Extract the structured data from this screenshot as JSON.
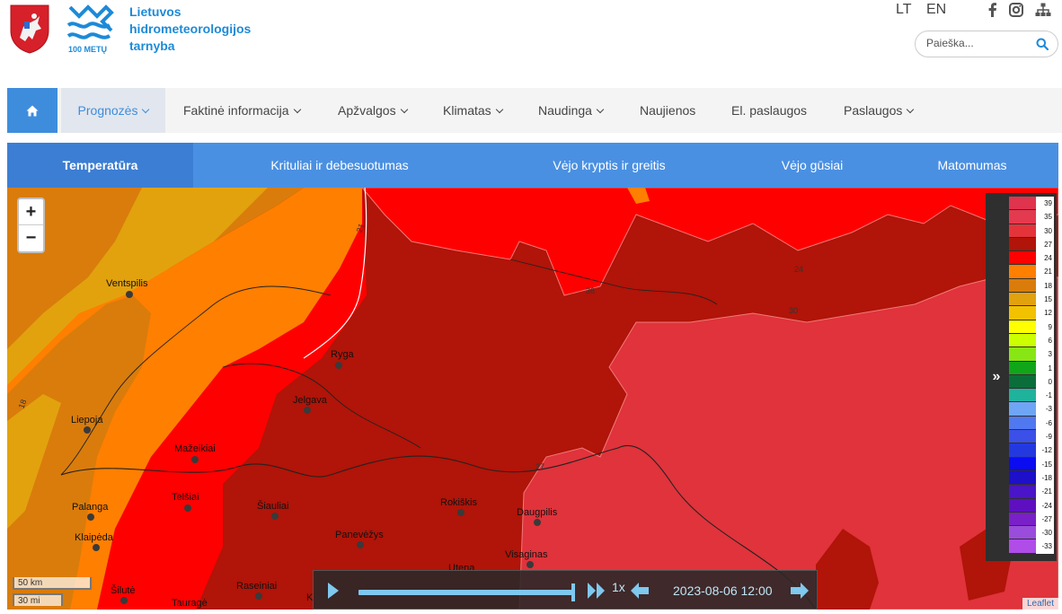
{
  "header": {
    "org_name_lines": [
      "Lietuvos",
      "hidrometeorologijos",
      "tarnyba"
    ],
    "logo_caption": "100 METŲ",
    "languages": [
      "LT",
      "EN"
    ],
    "social_icons": [
      "facebook-icon",
      "instagram-icon",
      "sitemap-icon"
    ],
    "search_placeholder": "Paieška...",
    "brand_color": "#1d8ad8"
  },
  "nav": {
    "home_icon": "home-icon",
    "items": [
      {
        "label": "Prognozės",
        "dropdown": true,
        "active": true
      },
      {
        "label": "Faktinė informacija",
        "dropdown": true
      },
      {
        "label": "Apžvalgos",
        "dropdown": true
      },
      {
        "label": "Klimatas",
        "dropdown": true
      },
      {
        "label": "Naudinga",
        "dropdown": true
      },
      {
        "label": "Naujienos",
        "dropdown": false
      },
      {
        "label": "El. paslaugos",
        "dropdown": false
      },
      {
        "label": "Paslaugos",
        "dropdown": true
      }
    ]
  },
  "tabs": [
    {
      "label": "Temperatūra",
      "active": true
    },
    {
      "label": "Krituliai ir debesuotumas"
    },
    {
      "label": "Vėjo kryptis ir greitis"
    },
    {
      "label": "Vėjo gūsiai"
    },
    {
      "label": "Matomumas"
    }
  ],
  "map": {
    "zoom_in": "+",
    "zoom_out": "−",
    "scale": [
      "50 km",
      "30 mi"
    ],
    "contour_labels": [
      "18",
      "21",
      "24",
      "27",
      "30",
      "36"
    ],
    "cities": [
      {
        "name": "Ventspilis"
      },
      {
        "name": "Ryga"
      },
      {
        "name": "Jelgava"
      },
      {
        "name": "Liepoja"
      },
      {
        "name": "Mažeikiai"
      },
      {
        "name": "Telšiai"
      },
      {
        "name": "Palanga"
      },
      {
        "name": "Klaipėda"
      },
      {
        "name": "Šiauliai"
      },
      {
        "name": "Panevėžys"
      },
      {
        "name": "Rokiškis"
      },
      {
        "name": "Daugpilis"
      },
      {
        "name": "Visaginas"
      },
      {
        "name": "Utena"
      },
      {
        "name": "Šilutė"
      },
      {
        "name": "Tauragė"
      },
      {
        "name": "Raseiniai"
      },
      {
        "name": "K"
      }
    ],
    "attribution": "Leaflet"
  },
  "legend": {
    "toggle": "»",
    "entries": [
      {
        "label": "39",
        "color": "#e0334d"
      },
      {
        "label": "35",
        "color": "#e33a4f"
      },
      {
        "label": "30",
        "color": "#e5333a"
      },
      {
        "label": "27",
        "color": "#b11408"
      },
      {
        "label": "24",
        "color": "#ff0000"
      },
      {
        "label": "21",
        "color": "#ff7f00"
      },
      {
        "label": "18",
        "color": "#d97c0c"
      },
      {
        "label": "15",
        "color": "#e2a20e"
      },
      {
        "label": "12",
        "color": "#f2c100"
      },
      {
        "label": "9",
        "color": "#ffff00"
      },
      {
        "label": "6",
        "color": "#ccff00"
      },
      {
        "label": "3",
        "color": "#88e614"
      },
      {
        "label": "1",
        "color": "#11a61a"
      },
      {
        "label": "0",
        "color": "#0b6e3a"
      },
      {
        "label": "-1",
        "color": "#1fb39b"
      },
      {
        "label": "-3",
        "color": "#6ea6f5"
      },
      {
        "label": "-6",
        "color": "#5078f0"
      },
      {
        "label": "-9",
        "color": "#3a50e8"
      },
      {
        "label": "-12",
        "color": "#2438e0"
      },
      {
        "label": "-15",
        "color": "#0c0cf0"
      },
      {
        "label": "-18",
        "color": "#1d10c8"
      },
      {
        "label": "-21",
        "color": "#4a14c8"
      },
      {
        "label": "-24",
        "color": "#5e10c0"
      },
      {
        "label": "-27",
        "color": "#7a20c8"
      },
      {
        "label": "-30",
        "color": "#9a4cdc"
      },
      {
        "label": "-33",
        "color": "#b04ce8"
      }
    ]
  },
  "player": {
    "speed": "1x",
    "timestamp": "2023-08-06 12:00",
    "progress": 1.0
  }
}
